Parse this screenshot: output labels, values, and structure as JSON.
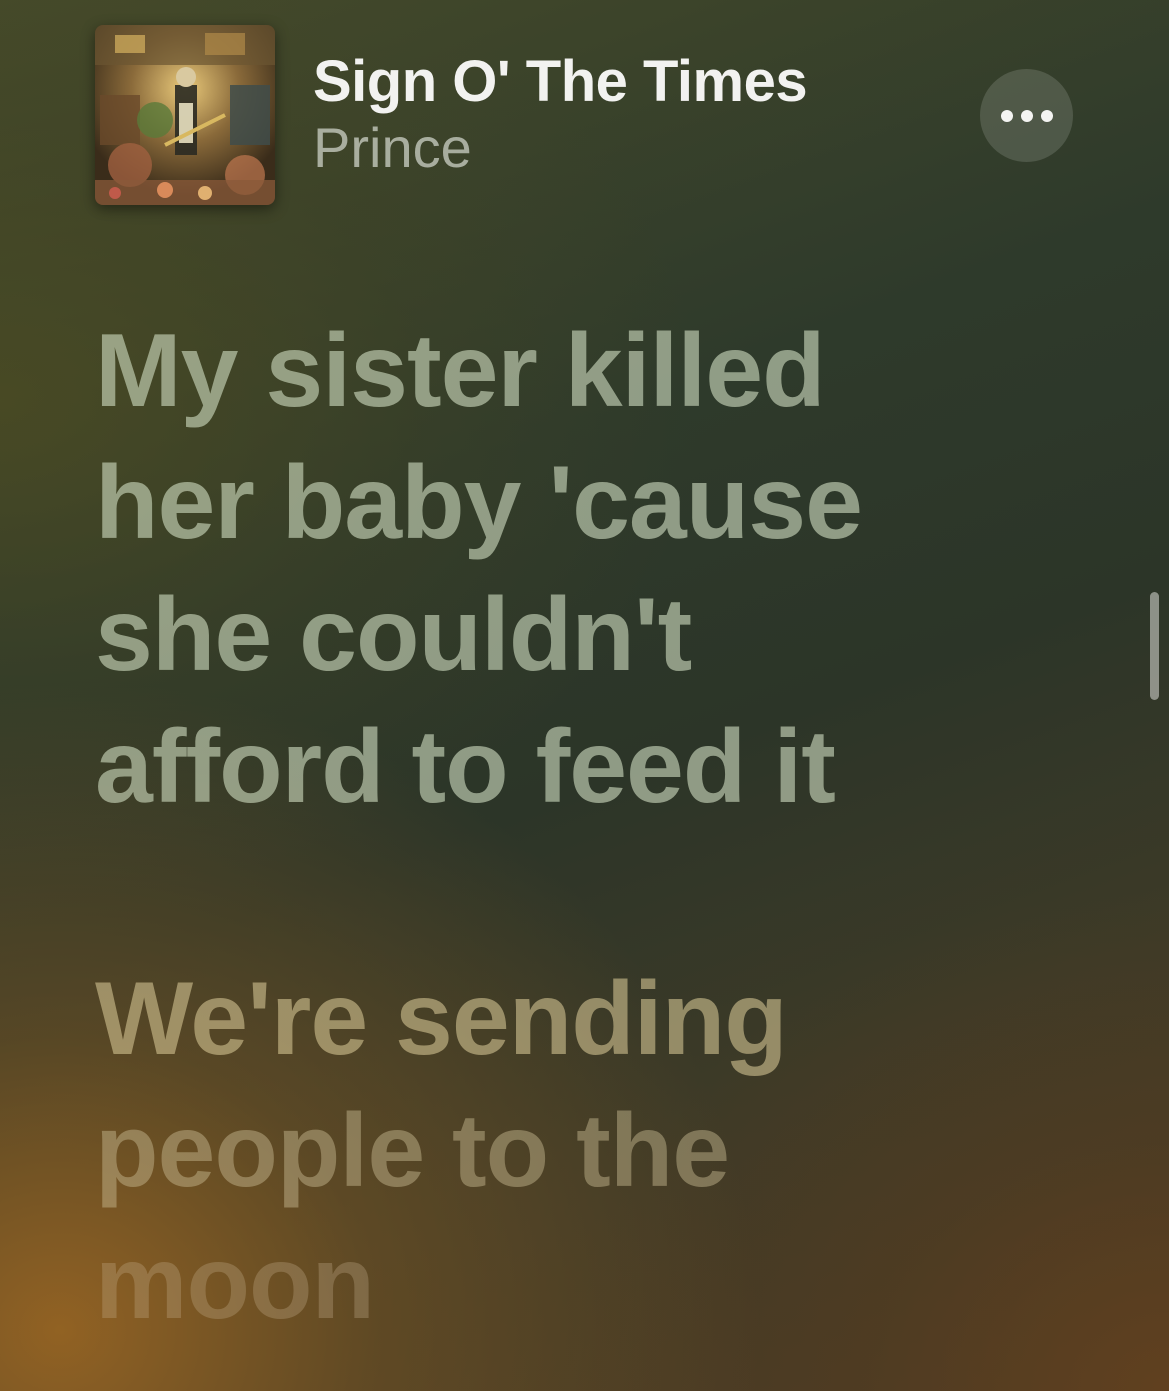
{
  "now_playing": {
    "title": "Sign O' The Times",
    "artist": "Prince",
    "album_art_icon": "album-cover-art",
    "more_icon": "ellipsis-icon"
  },
  "lyrics": {
    "stanza_1": [
      "My sister killed",
      "her baby 'cause",
      "she couldn't",
      "afford to feed it"
    ],
    "stanza_2": [
      "We're sending",
      "people to the",
      "moon"
    ]
  },
  "colors": {
    "title": "#f2f2f0",
    "background_top": "#2e3a2b",
    "background_bottom_left": "#96642a"
  }
}
